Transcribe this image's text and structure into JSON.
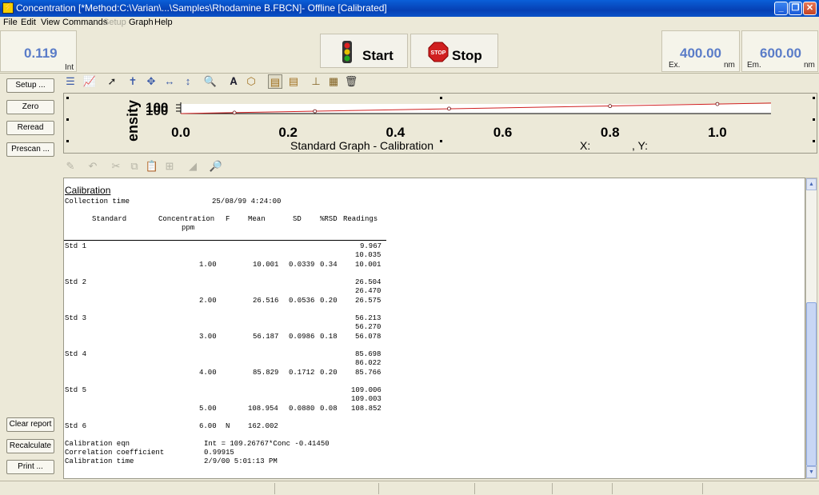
{
  "window": {
    "title": "Concentration [*Method:C:\\Varian\\...\\Samples\\Rhodamine B.FBCN]- Offline [Calibrated]",
    "minimize": "_",
    "maximize": "❐",
    "close": "✕"
  },
  "menu": [
    "File",
    "Edit",
    "View",
    "Commands",
    "Setup",
    "Graph",
    "Help"
  ],
  "readouts": {
    "intensity": {
      "value": "0.119",
      "unit": "Int"
    },
    "ex": {
      "value": "400.00",
      "label": "Ex.",
      "unit": "nm"
    },
    "em": {
      "value": "600.00",
      "label": "Em.",
      "unit": "nm"
    }
  },
  "buttons": {
    "start": "Start",
    "stop": "Stop",
    "stop_sign": "STOP"
  },
  "left_buttons": {
    "setup": "Setup ...",
    "zero": "Zero",
    "reread": "Reread",
    "prescan": "Prescan ...",
    "clear_report": "Clear report",
    "recalculate": "Recalculate",
    "print": "Print ..."
  },
  "graph": {
    "ylabel": "ensity",
    "ytick": "100",
    "xticks": [
      "0.0",
      "0.2",
      "0.4",
      "0.6",
      "0.8",
      "1.0"
    ],
    "caption": "Standard Graph - Calibration",
    "x_label": "X:",
    "y_label": ", Y:"
  },
  "chart_data": {
    "type": "scatter",
    "x": [
      0.1,
      0.25,
      0.5,
      0.8,
      1.0
    ],
    "y": [
      10.0,
      26.5,
      56.2,
      85.8,
      109.0
    ],
    "xlim": [
      0.0,
      1.1
    ],
    "ylim": [
      0,
      110
    ],
    "trendline": true
  },
  "report": {
    "heading": "Calibration",
    "collection_label": "Collection time",
    "collection_value": "25/08/99 4:24:00",
    "columns": {
      "standard": "Standard",
      "concentration": "Concentration",
      "units": "ppm",
      "f": "F",
      "mean": "Mean",
      "sd": "SD",
      "rsd": "%RSD",
      "readings": "Readings"
    },
    "standards": [
      {
        "name": "Std 1",
        "conc": "1.00",
        "f": "",
        "mean": "10.001",
        "sd": "0.0339",
        "rsd": "0.34",
        "readings": [
          "9.967",
          "10.035",
          "10.001"
        ]
      },
      {
        "name": "Std 2",
        "conc": "2.00",
        "f": "",
        "mean": "26.516",
        "sd": "0.0536",
        "rsd": "0.20",
        "readings": [
          "26.504",
          "26.470",
          "26.575"
        ]
      },
      {
        "name": "Std 3",
        "conc": "3.00",
        "f": "",
        "mean": "56.187",
        "sd": "0.0986",
        "rsd": "0.18",
        "readings": [
          "56.213",
          "56.270",
          "56.078"
        ]
      },
      {
        "name": "Std 4",
        "conc": "4.00",
        "f": "",
        "mean": "85.829",
        "sd": "0.1712",
        "rsd": "0.20",
        "readings": [
          "85.698",
          "86.022",
          "85.766"
        ]
      },
      {
        "name": "Std 5",
        "conc": "5.00",
        "f": "",
        "mean": "108.954",
        "sd": "0.0880",
        "rsd": "0.08",
        "readings": [
          "109.006",
          "109.003",
          "108.852"
        ]
      },
      {
        "name": "Std 6",
        "conc": "6.00",
        "f": "N",
        "mean": "162.002",
        "sd": "",
        "rsd": "",
        "readings": []
      }
    ],
    "eqn_label": "Calibration eqn",
    "eqn_value": "Int = 109.26767*Conc -0.41450",
    "coef_label": "Correlation coefficient",
    "coef_value": "0.99915",
    "caltime_label": "Calibration time",
    "caltime_value": "2/9/00 5:01:13 PM"
  },
  "scroll": {
    "up": "▲",
    "down": "▼"
  },
  "icons": {
    "toolbar": [
      "list-icon",
      "graph-icon",
      "pointer-icon",
      "cursor-icon",
      "move-icon",
      "h-resize-icon",
      "v-resize-icon",
      "zoom-icon",
      "text-icon",
      "label-icon",
      "format-a-icon",
      "format-b-icon",
      "axes-icon",
      "graph-props-icon",
      "delete-icon"
    ],
    "report_toolbar": [
      "edit-icon",
      "undo-icon",
      "cut-icon",
      "copy-icon",
      "paste-icon",
      "paste-special-icon",
      "bell-icon",
      "preview-icon"
    ]
  },
  "colors": {
    "accent": "#5a7cc8",
    "trend": "#d02020"
  }
}
